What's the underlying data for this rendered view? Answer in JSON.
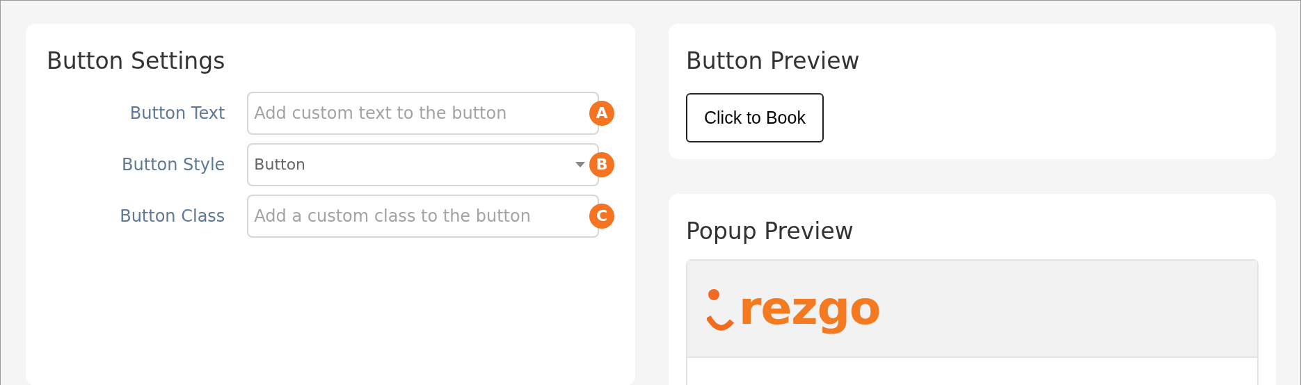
{
  "settings": {
    "title": "Button Settings",
    "fields": [
      {
        "kind": "input",
        "label": "Button Text",
        "placeholder": "Add custom text to the button",
        "marker": "A"
      },
      {
        "kind": "select",
        "label": "Button Style",
        "value": "Button",
        "marker": "B"
      },
      {
        "kind": "input",
        "label": "Button Class",
        "placeholder": "Add a custom class to the button",
        "marker": "C"
      }
    ]
  },
  "button_preview": {
    "title": "Button Preview",
    "button": "Click to Book"
  },
  "popup_preview": {
    "title": "Popup Preview",
    "logo": "rezgo"
  }
}
